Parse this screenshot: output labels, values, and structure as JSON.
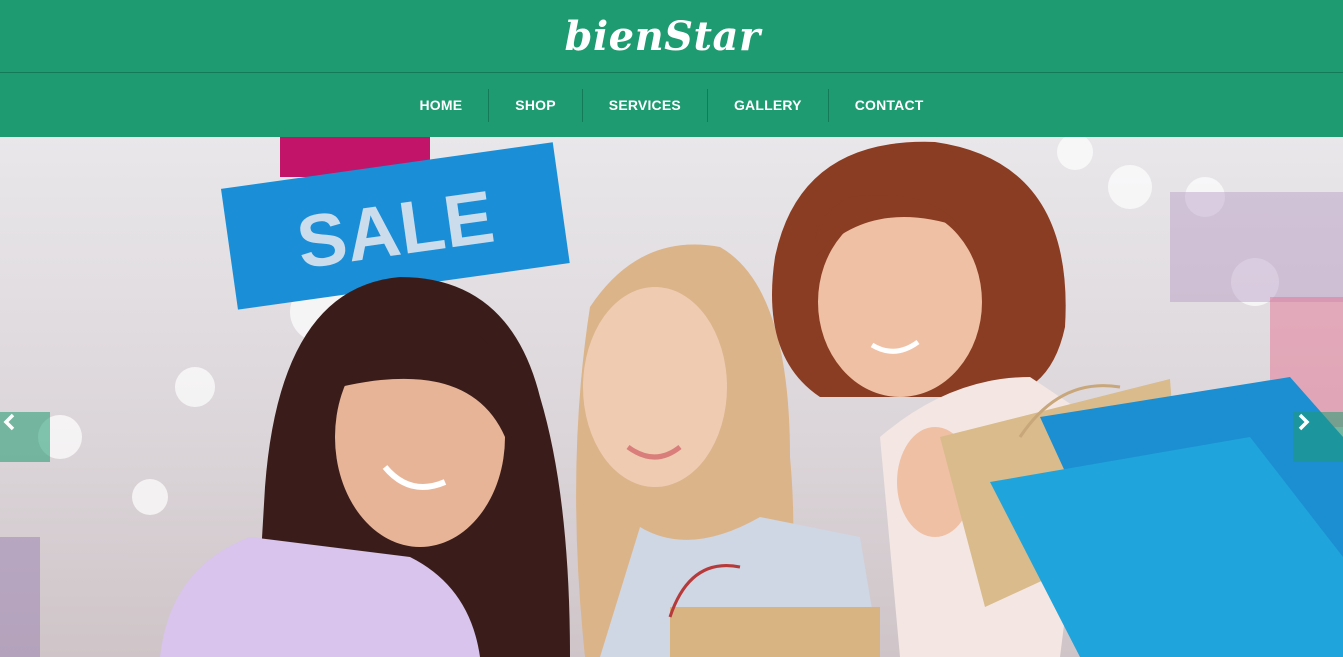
{
  "brand": {
    "logo_text": "bienStar"
  },
  "nav": {
    "items": [
      {
        "label": "HOME"
      },
      {
        "label": "SHOP"
      },
      {
        "label": "SERVICES"
      },
      {
        "label": "GALLERY"
      },
      {
        "label": "CONTACT"
      }
    ]
  },
  "hero": {
    "sign_text": "SALE",
    "prev_icon": "chevron-left-icon",
    "next_icon": "chevron-right-icon"
  },
  "colors": {
    "brand_green": "#1f9b71",
    "divider_green": "#147a57",
    "sign_blue": "#1a8fd8",
    "bag_blue": "#20a4dc"
  }
}
